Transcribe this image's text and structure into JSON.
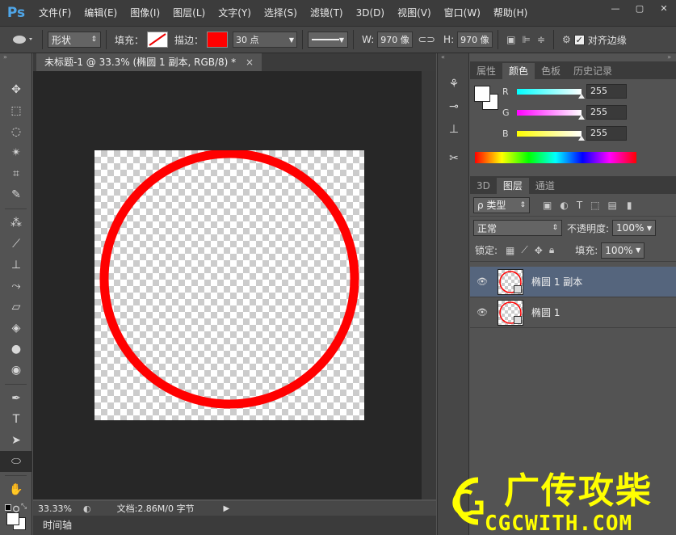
{
  "app": {
    "logo": "Ps"
  },
  "menu": [
    "文件(F)",
    "编辑(E)",
    "图像(I)",
    "图层(L)",
    "文字(Y)",
    "选择(S)",
    "滤镜(T)",
    "3D(D)",
    "视图(V)",
    "窗口(W)",
    "帮助(H)"
  ],
  "window_buttons": {
    "minimize": "—",
    "restore": "▢",
    "close": "✕"
  },
  "options": {
    "mode": "形状",
    "fill_label": "填充：",
    "stroke_label": "描边：",
    "stroke_color": "#ff0000",
    "stroke_width": "30 点",
    "w_label": "W:",
    "w_value": "970 像",
    "h_label": "H:",
    "h_value": "970 像",
    "align_edges_label": "对齐边缘",
    "align_edges_checked": true
  },
  "document": {
    "tab_title": "未标题-1 @ 33.3% (椭圆 1 副本, RGB/8) *",
    "ellipse_color": "#ff0000"
  },
  "status": {
    "zoom": "33.33%",
    "doc_info": "文档:2.86M/0 字节",
    "timeline": "时间轴"
  },
  "color_panel": {
    "tabs": [
      "属性",
      "颜色",
      "色板",
      "历史记录"
    ],
    "active_tab": "颜色",
    "channels": [
      {
        "label": "R",
        "value": "255",
        "color": "#00e5e5"
      },
      {
        "label": "G",
        "value": "255",
        "color": "#e000e0"
      },
      {
        "label": "B",
        "value": "255",
        "color": "#e5e500"
      }
    ]
  },
  "layers_panel": {
    "tabs": [
      "3D",
      "图层",
      "通道"
    ],
    "active_tab": "图层",
    "filter_label": "ρ 类型",
    "blend_mode": "正常",
    "opacity_label": "不透明度:",
    "opacity_value": "100%",
    "lock_label": "锁定:",
    "fill_label": "填充:",
    "fill_value": "100%",
    "layers": [
      {
        "name": "椭圆 1 副本",
        "selected": true
      },
      {
        "name": "椭圆 1",
        "selected": false
      }
    ]
  },
  "watermark": {
    "title": "广传攻柴",
    "url": "CGCWITH.COM",
    "color": "#ffff00"
  }
}
